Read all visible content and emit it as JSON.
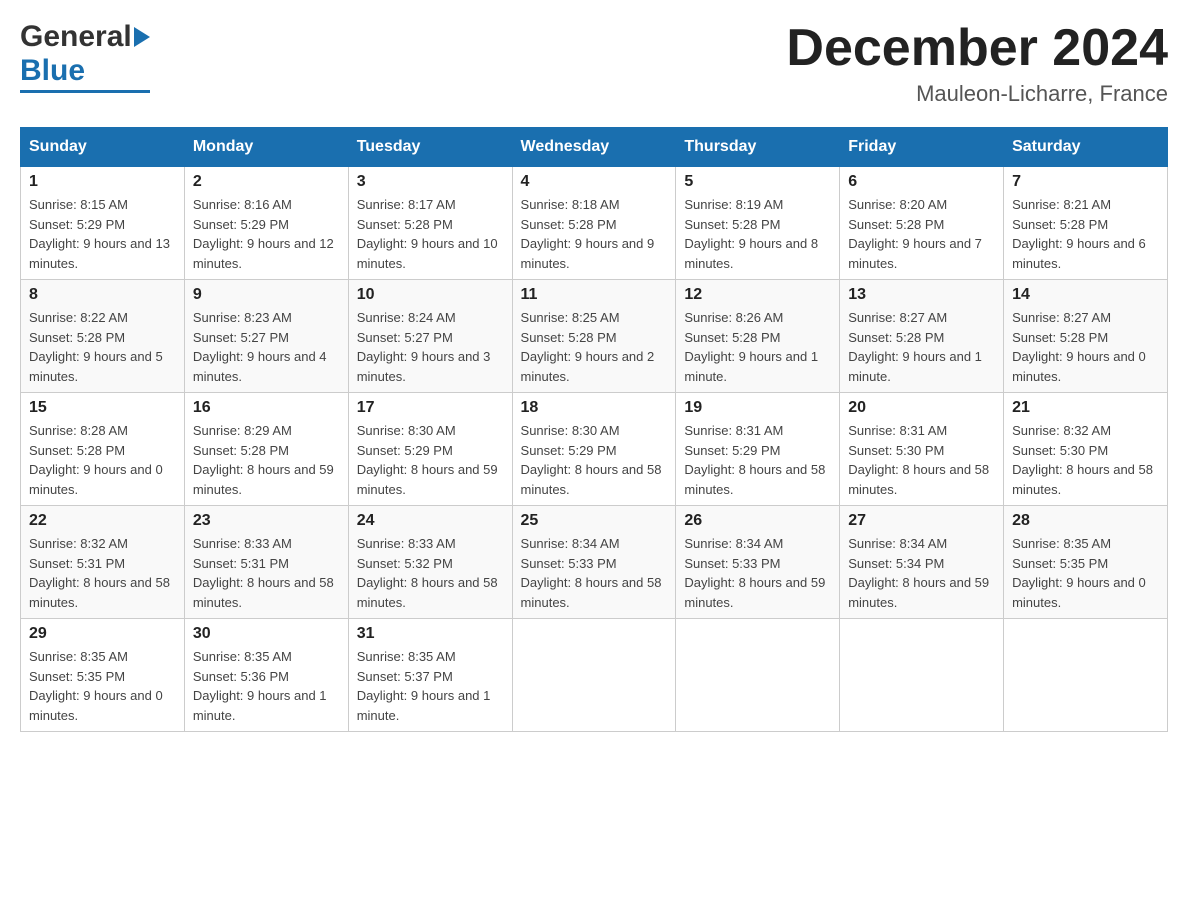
{
  "header": {
    "logo_general": "General",
    "logo_blue": "Blue",
    "month_title": "December 2024",
    "location": "Mauleon-Licharre, France"
  },
  "calendar": {
    "days_of_week": [
      "Sunday",
      "Monday",
      "Tuesday",
      "Wednesday",
      "Thursday",
      "Friday",
      "Saturday"
    ],
    "weeks": [
      [
        {
          "date": "1",
          "sunrise": "Sunrise: 8:15 AM",
          "sunset": "Sunset: 5:29 PM",
          "daylight": "Daylight: 9 hours and 13 minutes."
        },
        {
          "date": "2",
          "sunrise": "Sunrise: 8:16 AM",
          "sunset": "Sunset: 5:29 PM",
          "daylight": "Daylight: 9 hours and 12 minutes."
        },
        {
          "date": "3",
          "sunrise": "Sunrise: 8:17 AM",
          "sunset": "Sunset: 5:28 PM",
          "daylight": "Daylight: 9 hours and 10 minutes."
        },
        {
          "date": "4",
          "sunrise": "Sunrise: 8:18 AM",
          "sunset": "Sunset: 5:28 PM",
          "daylight": "Daylight: 9 hours and 9 minutes."
        },
        {
          "date": "5",
          "sunrise": "Sunrise: 8:19 AM",
          "sunset": "Sunset: 5:28 PM",
          "daylight": "Daylight: 9 hours and 8 minutes."
        },
        {
          "date": "6",
          "sunrise": "Sunrise: 8:20 AM",
          "sunset": "Sunset: 5:28 PM",
          "daylight": "Daylight: 9 hours and 7 minutes."
        },
        {
          "date": "7",
          "sunrise": "Sunrise: 8:21 AM",
          "sunset": "Sunset: 5:28 PM",
          "daylight": "Daylight: 9 hours and 6 minutes."
        }
      ],
      [
        {
          "date": "8",
          "sunrise": "Sunrise: 8:22 AM",
          "sunset": "Sunset: 5:28 PM",
          "daylight": "Daylight: 9 hours and 5 minutes."
        },
        {
          "date": "9",
          "sunrise": "Sunrise: 8:23 AM",
          "sunset": "Sunset: 5:27 PM",
          "daylight": "Daylight: 9 hours and 4 minutes."
        },
        {
          "date": "10",
          "sunrise": "Sunrise: 8:24 AM",
          "sunset": "Sunset: 5:27 PM",
          "daylight": "Daylight: 9 hours and 3 minutes."
        },
        {
          "date": "11",
          "sunrise": "Sunrise: 8:25 AM",
          "sunset": "Sunset: 5:28 PM",
          "daylight": "Daylight: 9 hours and 2 minutes."
        },
        {
          "date": "12",
          "sunrise": "Sunrise: 8:26 AM",
          "sunset": "Sunset: 5:28 PM",
          "daylight": "Daylight: 9 hours and 1 minute."
        },
        {
          "date": "13",
          "sunrise": "Sunrise: 8:27 AM",
          "sunset": "Sunset: 5:28 PM",
          "daylight": "Daylight: 9 hours and 1 minute."
        },
        {
          "date": "14",
          "sunrise": "Sunrise: 8:27 AM",
          "sunset": "Sunset: 5:28 PM",
          "daylight": "Daylight: 9 hours and 0 minutes."
        }
      ],
      [
        {
          "date": "15",
          "sunrise": "Sunrise: 8:28 AM",
          "sunset": "Sunset: 5:28 PM",
          "daylight": "Daylight: 9 hours and 0 minutes."
        },
        {
          "date": "16",
          "sunrise": "Sunrise: 8:29 AM",
          "sunset": "Sunset: 5:28 PM",
          "daylight": "Daylight: 8 hours and 59 minutes."
        },
        {
          "date": "17",
          "sunrise": "Sunrise: 8:30 AM",
          "sunset": "Sunset: 5:29 PM",
          "daylight": "Daylight: 8 hours and 59 minutes."
        },
        {
          "date": "18",
          "sunrise": "Sunrise: 8:30 AM",
          "sunset": "Sunset: 5:29 PM",
          "daylight": "Daylight: 8 hours and 58 minutes."
        },
        {
          "date": "19",
          "sunrise": "Sunrise: 8:31 AM",
          "sunset": "Sunset: 5:29 PM",
          "daylight": "Daylight: 8 hours and 58 minutes."
        },
        {
          "date": "20",
          "sunrise": "Sunrise: 8:31 AM",
          "sunset": "Sunset: 5:30 PM",
          "daylight": "Daylight: 8 hours and 58 minutes."
        },
        {
          "date": "21",
          "sunrise": "Sunrise: 8:32 AM",
          "sunset": "Sunset: 5:30 PM",
          "daylight": "Daylight: 8 hours and 58 minutes."
        }
      ],
      [
        {
          "date": "22",
          "sunrise": "Sunrise: 8:32 AM",
          "sunset": "Sunset: 5:31 PM",
          "daylight": "Daylight: 8 hours and 58 minutes."
        },
        {
          "date": "23",
          "sunrise": "Sunrise: 8:33 AM",
          "sunset": "Sunset: 5:31 PM",
          "daylight": "Daylight: 8 hours and 58 minutes."
        },
        {
          "date": "24",
          "sunrise": "Sunrise: 8:33 AM",
          "sunset": "Sunset: 5:32 PM",
          "daylight": "Daylight: 8 hours and 58 minutes."
        },
        {
          "date": "25",
          "sunrise": "Sunrise: 8:34 AM",
          "sunset": "Sunset: 5:33 PM",
          "daylight": "Daylight: 8 hours and 58 minutes."
        },
        {
          "date": "26",
          "sunrise": "Sunrise: 8:34 AM",
          "sunset": "Sunset: 5:33 PM",
          "daylight": "Daylight: 8 hours and 59 minutes."
        },
        {
          "date": "27",
          "sunrise": "Sunrise: 8:34 AM",
          "sunset": "Sunset: 5:34 PM",
          "daylight": "Daylight: 8 hours and 59 minutes."
        },
        {
          "date": "28",
          "sunrise": "Sunrise: 8:35 AM",
          "sunset": "Sunset: 5:35 PM",
          "daylight": "Daylight: 9 hours and 0 minutes."
        }
      ],
      [
        {
          "date": "29",
          "sunrise": "Sunrise: 8:35 AM",
          "sunset": "Sunset: 5:35 PM",
          "daylight": "Daylight: 9 hours and 0 minutes."
        },
        {
          "date": "30",
          "sunrise": "Sunrise: 8:35 AM",
          "sunset": "Sunset: 5:36 PM",
          "daylight": "Daylight: 9 hours and 1 minute."
        },
        {
          "date": "31",
          "sunrise": "Sunrise: 8:35 AM",
          "sunset": "Sunset: 5:37 PM",
          "daylight": "Daylight: 9 hours and 1 minute."
        },
        null,
        null,
        null,
        null
      ]
    ]
  }
}
